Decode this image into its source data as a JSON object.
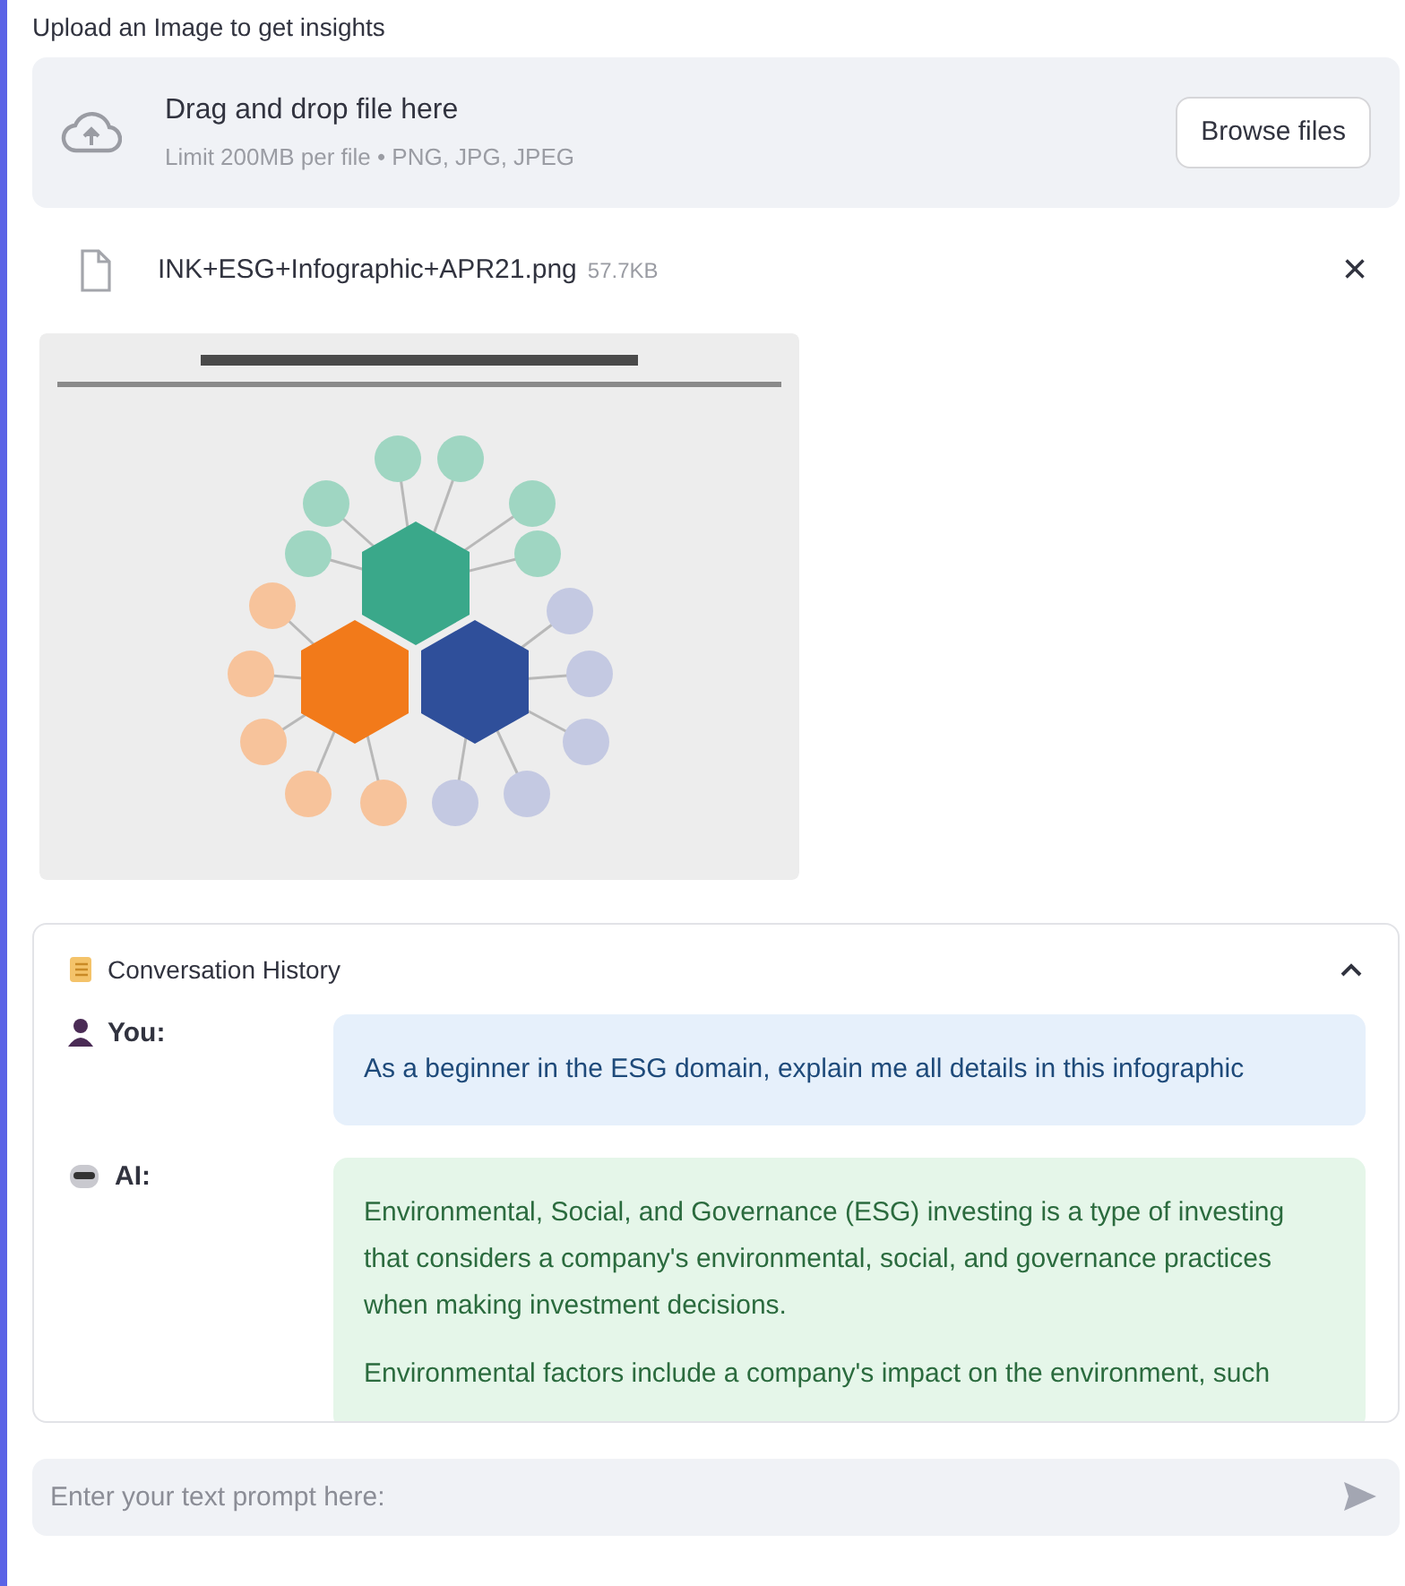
{
  "uploader": {
    "label": "Upload an Image to get insights",
    "dropzone_title": "Drag and drop file here",
    "dropzone_hint": "Limit 200MB per file • PNG, JPG, JPEG",
    "browse_button": "Browse files"
  },
  "file": {
    "name": "INK+ESG+Infographic+APR21.png",
    "size": "57.7KB",
    "remove": "×"
  },
  "history": {
    "title": "Conversation History",
    "expanded": true,
    "messages": [
      {
        "kind": "user",
        "role": "You:",
        "paragraphs": [
          "As a beginner in the ESG domain, explain me all details in this infographic"
        ]
      },
      {
        "kind": "ai",
        "role": "AI:",
        "paragraphs": [
          "Environmental, Social, and Governance (ESG) investing is a type of investing that considers a company's environmental, social, and governance practices when making investment decisions.",
          "Environmental factors include a company's impact on the environment, such"
        ]
      }
    ]
  },
  "prompt": {
    "placeholder": "Enter your text prompt here:"
  }
}
